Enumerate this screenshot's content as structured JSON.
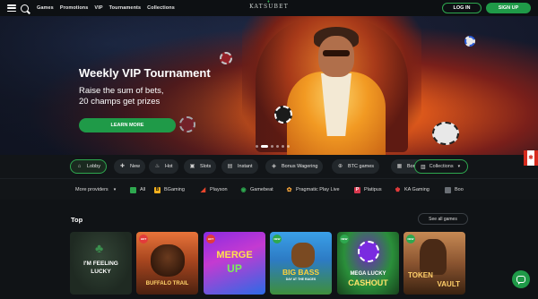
{
  "header": {
    "nav": [
      "Games",
      "Promotions",
      "VIP",
      "Tournaments",
      "Collections"
    ],
    "logo": "KATSUBET",
    "login_label": "LOG IN",
    "signup_label": "SIGN UP"
  },
  "hero": {
    "title": "Weekly VIP Tournament",
    "subtitle_line1": "Raise the sum of bets,",
    "subtitle_line2": "20 champs get prizes",
    "cta_label": "LEARN MORE",
    "slide_count": 6,
    "active_slide": 1
  },
  "categories": {
    "items": [
      {
        "label": "Lobby",
        "icon": "lobby-icon",
        "active": true
      },
      {
        "label": "New",
        "icon": "new-icon"
      },
      {
        "label": "Hot",
        "icon": "flame-icon"
      },
      {
        "label": "Slots",
        "icon": "slots-icon"
      },
      {
        "label": "Instant",
        "icon": "instant-icon"
      },
      {
        "label": "Bonus Wagering",
        "icon": "bonus-icon"
      },
      {
        "label": "BTC games",
        "icon": "btc-icon"
      },
      {
        "label": "Bon",
        "icon": "bonus-buy-icon"
      }
    ],
    "collections_label": "Collections"
  },
  "providers": {
    "more_label": "More providers",
    "items": [
      {
        "label": "All",
        "color": "#2ea84f"
      },
      {
        "label": "BGaming",
        "color": "#f2b01e"
      },
      {
        "label": "Playson",
        "color": "#e8452c"
      },
      {
        "label": "Gamebeat",
        "color": "#2ea84f"
      },
      {
        "label": "Pragmatic Play Live",
        "color": "#f2a23a"
      },
      {
        "label": "Platipus",
        "color": "#d9394f"
      },
      {
        "label": "KA Gaming",
        "color": "#e23b3b"
      },
      {
        "label": "Boo",
        "color": "#6a6f75"
      }
    ]
  },
  "top": {
    "title": "Top",
    "see_all_label": "See all games",
    "games": [
      {
        "name_line1": "I'M FEELING",
        "name_line2": "LUCKY",
        "badge": ""
      },
      {
        "name_line1": "BUFFALO TRAIL",
        "name_line2": "",
        "badge": "HOT"
      },
      {
        "name_line1": "MERGE",
        "name_line2": "UP",
        "badge": "HOT"
      },
      {
        "name_line1": "BIG BASS",
        "name_line2": "DAY AT THE RACES",
        "badge": "NEW"
      },
      {
        "name_line1": "MEGA LUCKY",
        "name_line2": "CASHOUT",
        "badge": "NEW"
      },
      {
        "name_line1": "TOKEN",
        "name_line2": "VAULT",
        "badge": "NEW"
      }
    ]
  },
  "colors": {
    "accent": "#1f9a48",
    "background": "#121518"
  }
}
